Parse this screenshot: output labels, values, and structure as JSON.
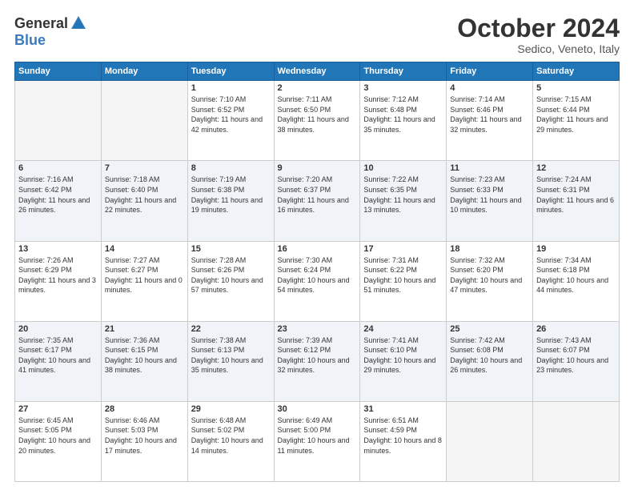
{
  "logo": {
    "general": "General",
    "blue": "Blue"
  },
  "header": {
    "month": "October 2024",
    "location": "Sedico, Veneto, Italy"
  },
  "weekdays": [
    "Sunday",
    "Monday",
    "Tuesday",
    "Wednesday",
    "Thursday",
    "Friday",
    "Saturday"
  ],
  "weeks": [
    [
      {
        "day": "",
        "sunrise": "",
        "sunset": "",
        "daylight": "",
        "empty": true
      },
      {
        "day": "",
        "sunrise": "",
        "sunset": "",
        "daylight": "",
        "empty": true
      },
      {
        "day": "1",
        "sunrise": "Sunrise: 7:10 AM",
        "sunset": "Sunset: 6:52 PM",
        "daylight": "Daylight: 11 hours and 42 minutes."
      },
      {
        "day": "2",
        "sunrise": "Sunrise: 7:11 AM",
        "sunset": "Sunset: 6:50 PM",
        "daylight": "Daylight: 11 hours and 38 minutes."
      },
      {
        "day": "3",
        "sunrise": "Sunrise: 7:12 AM",
        "sunset": "Sunset: 6:48 PM",
        "daylight": "Daylight: 11 hours and 35 minutes."
      },
      {
        "day": "4",
        "sunrise": "Sunrise: 7:14 AM",
        "sunset": "Sunset: 6:46 PM",
        "daylight": "Daylight: 11 hours and 32 minutes."
      },
      {
        "day": "5",
        "sunrise": "Sunrise: 7:15 AM",
        "sunset": "Sunset: 6:44 PM",
        "daylight": "Daylight: 11 hours and 29 minutes."
      }
    ],
    [
      {
        "day": "6",
        "sunrise": "Sunrise: 7:16 AM",
        "sunset": "Sunset: 6:42 PM",
        "daylight": "Daylight: 11 hours and 26 minutes."
      },
      {
        "day": "7",
        "sunrise": "Sunrise: 7:18 AM",
        "sunset": "Sunset: 6:40 PM",
        "daylight": "Daylight: 11 hours and 22 minutes."
      },
      {
        "day": "8",
        "sunrise": "Sunrise: 7:19 AM",
        "sunset": "Sunset: 6:38 PM",
        "daylight": "Daylight: 11 hours and 19 minutes."
      },
      {
        "day": "9",
        "sunrise": "Sunrise: 7:20 AM",
        "sunset": "Sunset: 6:37 PM",
        "daylight": "Daylight: 11 hours and 16 minutes."
      },
      {
        "day": "10",
        "sunrise": "Sunrise: 7:22 AM",
        "sunset": "Sunset: 6:35 PM",
        "daylight": "Daylight: 11 hours and 13 minutes."
      },
      {
        "day": "11",
        "sunrise": "Sunrise: 7:23 AM",
        "sunset": "Sunset: 6:33 PM",
        "daylight": "Daylight: 11 hours and 10 minutes."
      },
      {
        "day": "12",
        "sunrise": "Sunrise: 7:24 AM",
        "sunset": "Sunset: 6:31 PM",
        "daylight": "Daylight: 11 hours and 6 minutes."
      }
    ],
    [
      {
        "day": "13",
        "sunrise": "Sunrise: 7:26 AM",
        "sunset": "Sunset: 6:29 PM",
        "daylight": "Daylight: 11 hours and 3 minutes."
      },
      {
        "day": "14",
        "sunrise": "Sunrise: 7:27 AM",
        "sunset": "Sunset: 6:27 PM",
        "daylight": "Daylight: 11 hours and 0 minutes."
      },
      {
        "day": "15",
        "sunrise": "Sunrise: 7:28 AM",
        "sunset": "Sunset: 6:26 PM",
        "daylight": "Daylight: 10 hours and 57 minutes."
      },
      {
        "day": "16",
        "sunrise": "Sunrise: 7:30 AM",
        "sunset": "Sunset: 6:24 PM",
        "daylight": "Daylight: 10 hours and 54 minutes."
      },
      {
        "day": "17",
        "sunrise": "Sunrise: 7:31 AM",
        "sunset": "Sunset: 6:22 PM",
        "daylight": "Daylight: 10 hours and 51 minutes."
      },
      {
        "day": "18",
        "sunrise": "Sunrise: 7:32 AM",
        "sunset": "Sunset: 6:20 PM",
        "daylight": "Daylight: 10 hours and 47 minutes."
      },
      {
        "day": "19",
        "sunrise": "Sunrise: 7:34 AM",
        "sunset": "Sunset: 6:18 PM",
        "daylight": "Daylight: 10 hours and 44 minutes."
      }
    ],
    [
      {
        "day": "20",
        "sunrise": "Sunrise: 7:35 AM",
        "sunset": "Sunset: 6:17 PM",
        "daylight": "Daylight: 10 hours and 41 minutes."
      },
      {
        "day": "21",
        "sunrise": "Sunrise: 7:36 AM",
        "sunset": "Sunset: 6:15 PM",
        "daylight": "Daylight: 10 hours and 38 minutes."
      },
      {
        "day": "22",
        "sunrise": "Sunrise: 7:38 AM",
        "sunset": "Sunset: 6:13 PM",
        "daylight": "Daylight: 10 hours and 35 minutes."
      },
      {
        "day": "23",
        "sunrise": "Sunrise: 7:39 AM",
        "sunset": "Sunset: 6:12 PM",
        "daylight": "Daylight: 10 hours and 32 minutes."
      },
      {
        "day": "24",
        "sunrise": "Sunrise: 7:41 AM",
        "sunset": "Sunset: 6:10 PM",
        "daylight": "Daylight: 10 hours and 29 minutes."
      },
      {
        "day": "25",
        "sunrise": "Sunrise: 7:42 AM",
        "sunset": "Sunset: 6:08 PM",
        "daylight": "Daylight: 10 hours and 26 minutes."
      },
      {
        "day": "26",
        "sunrise": "Sunrise: 7:43 AM",
        "sunset": "Sunset: 6:07 PM",
        "daylight": "Daylight: 10 hours and 23 minutes."
      }
    ],
    [
      {
        "day": "27",
        "sunrise": "Sunrise: 6:45 AM",
        "sunset": "Sunset: 5:05 PM",
        "daylight": "Daylight: 10 hours and 20 minutes."
      },
      {
        "day": "28",
        "sunrise": "Sunrise: 6:46 AM",
        "sunset": "Sunset: 5:03 PM",
        "daylight": "Daylight: 10 hours and 17 minutes."
      },
      {
        "day": "29",
        "sunrise": "Sunrise: 6:48 AM",
        "sunset": "Sunset: 5:02 PM",
        "daylight": "Daylight: 10 hours and 14 minutes."
      },
      {
        "day": "30",
        "sunrise": "Sunrise: 6:49 AM",
        "sunset": "Sunset: 5:00 PM",
        "daylight": "Daylight: 10 hours and 11 minutes."
      },
      {
        "day": "31",
        "sunrise": "Sunrise: 6:51 AM",
        "sunset": "Sunset: 4:59 PM",
        "daylight": "Daylight: 10 hours and 8 minutes."
      },
      {
        "day": "",
        "sunrise": "",
        "sunset": "",
        "daylight": "",
        "empty": true
      },
      {
        "day": "",
        "sunrise": "",
        "sunset": "",
        "daylight": "",
        "empty": true
      }
    ]
  ]
}
